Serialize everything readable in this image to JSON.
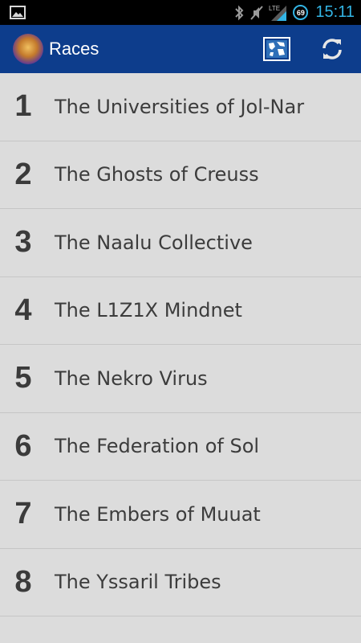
{
  "status_bar": {
    "time": "15:11",
    "battery": "69",
    "network": "LTE",
    "icons": [
      "gallery-icon",
      "bluetooth-icon",
      "mute-icon",
      "signal-icon",
      "battery-icon"
    ]
  },
  "action_bar": {
    "title": "Races",
    "icons": [
      "app-logo-icon",
      "map-icon",
      "refresh-icon"
    ]
  },
  "races": [
    {
      "number": "1",
      "name": "The Universities of Jol-Nar"
    },
    {
      "number": "2",
      "name": "The Ghosts of Creuss"
    },
    {
      "number": "3",
      "name": "The Naalu Collective"
    },
    {
      "number": "4",
      "name": "The L1Z1X Mindnet"
    },
    {
      "number": "5",
      "name": "The Nekro Virus"
    },
    {
      "number": "6",
      "name": "The Federation of Sol"
    },
    {
      "number": "7",
      "name": "The Embers of Muuat"
    },
    {
      "number": "8",
      "name": "The Yssaril Tribes"
    }
  ],
  "colors": {
    "action_bar": "#0d3d8c",
    "status_accent": "#33b5e5",
    "list_background": "#dcdcdc",
    "text": "#3c3c3c"
  }
}
